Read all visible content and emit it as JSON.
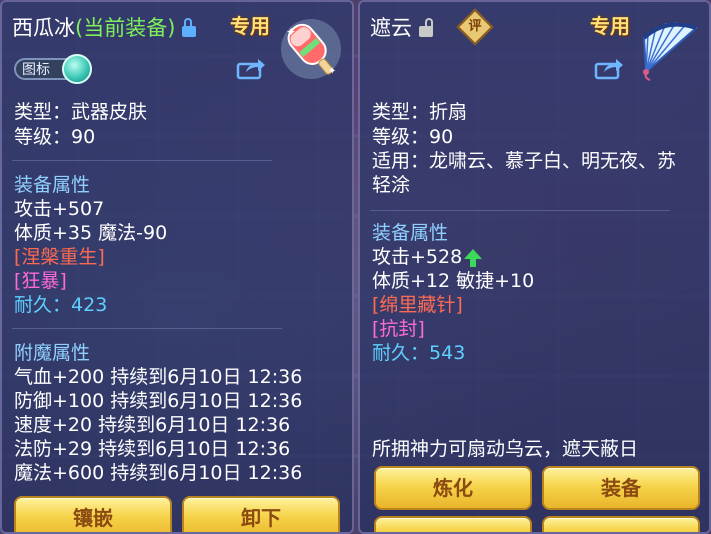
{
  "left_panel": {
    "item_name": "西瓜冰",
    "equipped_tag": "(当前装备)",
    "exclusive_tag": "专用",
    "toggle_label": "图标",
    "type_line": "类型：武器皮肤",
    "level_line": "等级：90",
    "equip_attr_header": "装备属性",
    "attrs": [
      "攻击+507",
      "体质+35 魔法-90"
    ],
    "special_effect": "[涅槃重生]",
    "special_skill": "[狂暴]",
    "durability_label": "耐久：",
    "durability_value": "423",
    "enchant_header": "附魔属性",
    "enchants": [
      "气血+200 持续到6月10日 12:36",
      "防御+100 持续到6月10日 12:36",
      "速度+20 持续到6月10日 12:36",
      "法防+29 持续到6月10日 12:36",
      "魔法+600 持续到6月10日 12:36"
    ],
    "buttons": [
      "镶嵌",
      "卸下"
    ]
  },
  "right_panel": {
    "item_name": "遮云",
    "eval_badge": "评",
    "exclusive_tag": "专用",
    "type_line": "类型：折扇",
    "level_line": "等级：90",
    "suitable_line1": "适用：龙啸云、慕子白、明无夜、苏",
    "suitable_line2": "轻涂",
    "equip_attr_header": "装备属性",
    "attack": "攻击+528",
    "attr2": "体质+12 敏捷+10",
    "special_effect": "[绵里藏针]",
    "special_skill": "[抗封]",
    "durability_label": "耐久：",
    "durability_value": "543",
    "description": "所拥神力可扇动乌云，遮天蔽日",
    "buttons": [
      "炼化",
      "装备"
    ]
  },
  "colors": {
    "panel_bg": "#303a6e",
    "title_white": "#ffffff",
    "equipped_green": "#7df05a",
    "section_blue": "#8fd0ff",
    "special_red": "#ff6a52",
    "skill_pink": "#ff6ad8",
    "durability_cyan": "#5ed0ff",
    "button_gold": "#f6d44c",
    "button_text": "#8a4a10",
    "exclusive_gold": "#ffe17a"
  },
  "icons": [
    "lock-icon",
    "unlock-icon",
    "share-icon",
    "popsicle-weapon-icon",
    "folding-fan-icon",
    "stat-up-arrow-icon"
  ]
}
